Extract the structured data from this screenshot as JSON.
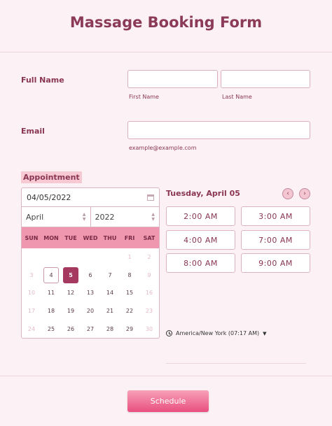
{
  "form": {
    "title": "Massage Booking Form",
    "full_name_label": "Full Name",
    "first_name_sublabel": "First Name",
    "last_name_sublabel": "Last Name",
    "first_name_value": "",
    "last_name_value": "",
    "email_label": "Email",
    "email_value": "",
    "email_sublabel": "example@example.com",
    "appointment_label": "Appointment",
    "submit_label": "Schedule"
  },
  "calendar": {
    "date_value": "04/05/2022",
    "month": "April",
    "year": "2022",
    "weekdays": [
      "SUN",
      "MON",
      "TUE",
      "WED",
      "THU",
      "FRI",
      "SAT"
    ],
    "selected_day": "5",
    "today_day": "4",
    "days": [
      {
        "d": "",
        "s": "blank"
      },
      {
        "d": "",
        "s": "blank"
      },
      {
        "d": "",
        "s": "blank"
      },
      {
        "d": "",
        "s": "blank"
      },
      {
        "d": "",
        "s": "blank"
      },
      {
        "d": "1",
        "s": "dis"
      },
      {
        "d": "2",
        "s": "dis"
      },
      {
        "d": "3",
        "s": "dis"
      },
      {
        "d": "4",
        "s": "today"
      },
      {
        "d": "5",
        "s": "sel"
      },
      {
        "d": "6",
        "s": ""
      },
      {
        "d": "7",
        "s": ""
      },
      {
        "d": "8",
        "s": ""
      },
      {
        "d": "9",
        "s": "dis"
      },
      {
        "d": "10",
        "s": "dis"
      },
      {
        "d": "11",
        "s": ""
      },
      {
        "d": "12",
        "s": ""
      },
      {
        "d": "13",
        "s": ""
      },
      {
        "d": "14",
        "s": ""
      },
      {
        "d": "15",
        "s": ""
      },
      {
        "d": "16",
        "s": "dis"
      },
      {
        "d": "17",
        "s": "dis"
      },
      {
        "d": "18",
        "s": ""
      },
      {
        "d": "19",
        "s": ""
      },
      {
        "d": "20",
        "s": ""
      },
      {
        "d": "21",
        "s": ""
      },
      {
        "d": "22",
        "s": ""
      },
      {
        "d": "23",
        "s": "dis"
      },
      {
        "d": "24",
        "s": "dis"
      },
      {
        "d": "25",
        "s": ""
      },
      {
        "d": "26",
        "s": ""
      },
      {
        "d": "27",
        "s": ""
      },
      {
        "d": "28",
        "s": ""
      },
      {
        "d": "29",
        "s": ""
      },
      {
        "d": "30",
        "s": "dis"
      }
    ]
  },
  "slots": {
    "heading": "Tuesday, April 05",
    "times": [
      "2:00 AM",
      "3:00 AM",
      "4:00 AM",
      "7:00 AM",
      "8:00 AM",
      "9:00 AM"
    ],
    "timezone": "America/New York (07:17 AM)",
    "prev_icon": "chevron-left-icon",
    "next_icon": "chevron-right-icon"
  },
  "colors": {
    "accent": "#a5395f",
    "header_bg": "#ef97ae",
    "page_bg": "#fcf2f5",
    "button": "#e94f80"
  }
}
